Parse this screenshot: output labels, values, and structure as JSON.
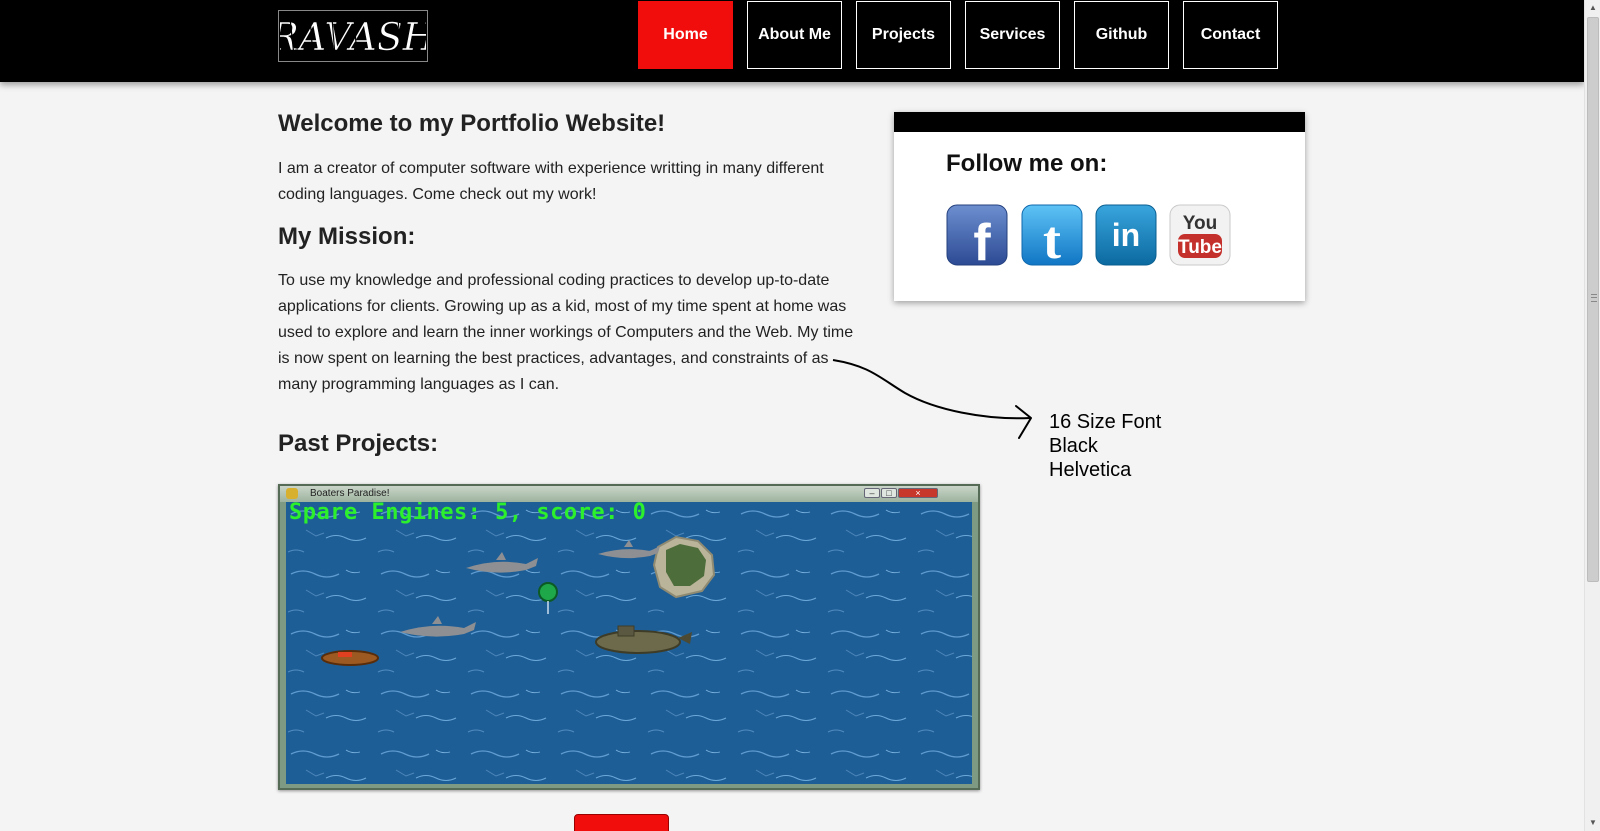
{
  "header": {
    "logo_text": "RAVASH",
    "nav": [
      {
        "label": "Home",
        "active": true
      },
      {
        "label": "About Me",
        "active": false
      },
      {
        "label": "Projects",
        "active": false
      },
      {
        "label": "Services",
        "active": false
      },
      {
        "label": "Github",
        "active": false
      },
      {
        "label": "Contact",
        "active": false
      }
    ]
  },
  "main": {
    "welcome_title": "Welcome to my Portfolio Website!",
    "welcome_text": "I am a creator of computer software with experience writting in many different coding languages. Come check out my work!",
    "mission_title": "My Mission:",
    "mission_text": "To use my knowledge and professional coding practices to develop up-to-date applications for clients. Growing up as a kid, most of my time spent at home was used to explore and learn the inner workings of Computers and the Web. My time is now spent on learning the best practices, advantages, and constraints of as many programming languages as I can.",
    "past_projects_title": "Past Projects:"
  },
  "sidebar": {
    "follow_title": "Follow me on:",
    "social": [
      {
        "icon": "facebook-icon",
        "text": "f",
        "color": "#3b5998"
      },
      {
        "icon": "twitter-icon",
        "text": "t",
        "color": "#1d8fd6"
      },
      {
        "icon": "linkedin-icon",
        "text": "in",
        "color": "#0e76a8"
      },
      {
        "icon": "youtube-icon",
        "text_top": "You",
        "text_bottom": "Tube",
        "color": "#c4302b"
      }
    ]
  },
  "annotation": {
    "line1": "16 Size Font",
    "line2": "Black",
    "line3": "Helvetica"
  },
  "game": {
    "window_title": "Boaters Paradise!",
    "score_text": "Spare Engines: 5, score: 0"
  },
  "colors": {
    "accent_red": "#f20d0d",
    "header_bg": "#000000",
    "page_bg": "#f4f4f4",
    "score_green": "#2cf02c",
    "water": "#1e5e96"
  }
}
